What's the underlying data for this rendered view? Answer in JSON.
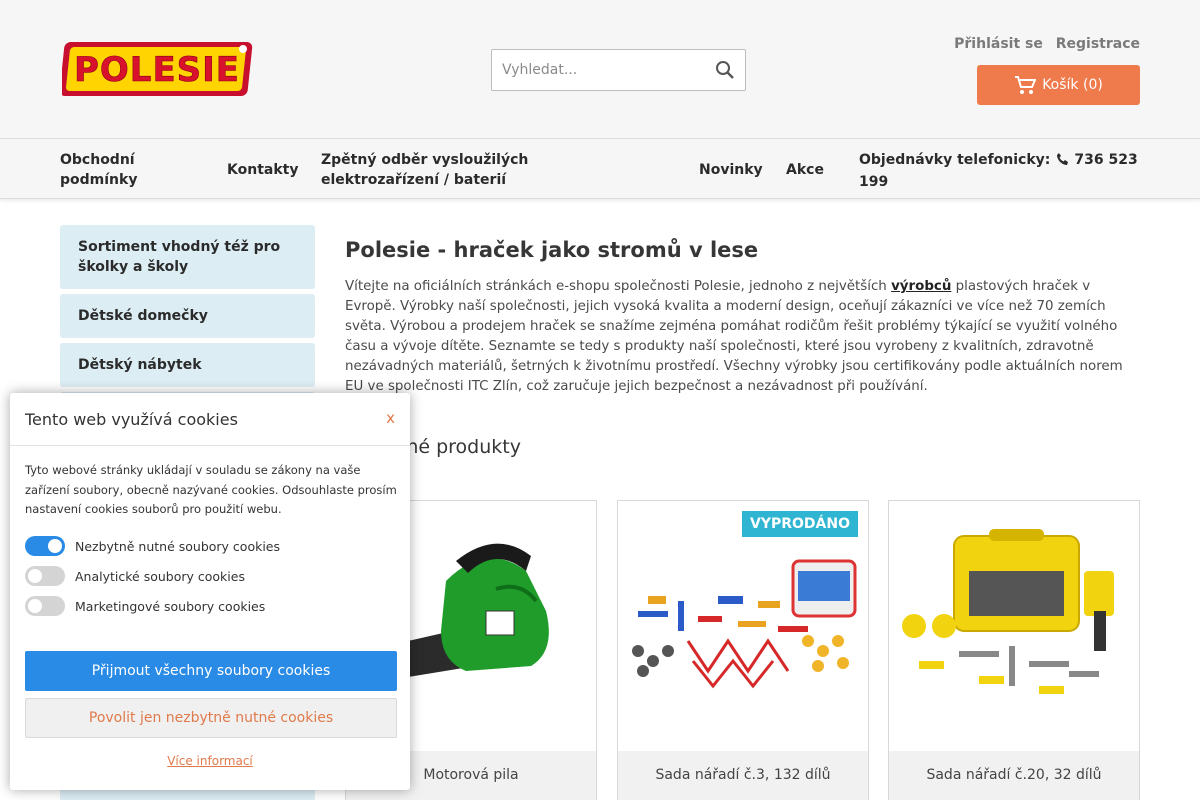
{
  "header": {
    "logo_text": "POLESIE",
    "search_placeholder": "Vyhledat...",
    "login": "Přihlásit se",
    "register": "Registrace",
    "cart": "Košík (0)"
  },
  "nav": {
    "items": [
      "Obchodní podmínky",
      "Kontakty",
      "Zpětný odběr vysloužilých elektrozařízení / baterií",
      "Novinky",
      "Akce"
    ],
    "phone_label": "Objednávky telefonicky:",
    "phone_number": "736 523 199"
  },
  "sidebar": {
    "items": [
      "Sortiment vhodný též pro školky a školy",
      "Dětské domečky",
      "Dětský nábytek"
    ]
  },
  "main": {
    "title": "Polesie - hraček jako stromů v lese",
    "intro_1": "Vítejte na oficiálních stránkách e-shopu společnosti Polesie, jednoho z největších ",
    "intro_link": "výrobců",
    "intro_2": " plastových hraček v Evropě. Výrobky naší společnosti, jejich vysoká kvalita a moderní design, oceňují zákazníci ve více než 70 zemích světa. Výrobou a prodejem hraček se snažíme zejména pomáhat rodičům řešit problémy týkající se využití volného času a vývoje dítěte. Seznamte se tedy s produkty naší společnosti, které jsou vyrobeny z kvalitních, zdravotně nezávadných materiálů, šetrných k životnímu prostředí. Všechny výrobky jsou certifikovány podle aktuálních norem EU ve společnosti ITC Zlín, což zaručuje jejich bezpečnost a nezávadnost při používání.",
    "section_title": "Oblíbené produkty"
  },
  "products": [
    {
      "name": "Motorová pila"
    },
    {
      "name": "Sada nářadí č.3, 132 dílů",
      "badge": "VYPRODÁNO"
    },
    {
      "name": "Sada nářadí č.20, 32 dílů"
    }
  ],
  "cookies": {
    "title": "Tento web využívá cookies",
    "close": "x",
    "text": "Tyto webové stránky ukládají v souladu se zákony na vaše zařízení soubory, obecně nazývané cookies. Odsouhlaste prosím nastavení cookies souborů pro použití webu.",
    "toggles": [
      {
        "label": "Nezbytně nutné soubory cookies",
        "on": true
      },
      {
        "label": "Analytické soubory cookies",
        "on": false
      },
      {
        "label": "Marketingové soubory cookies",
        "on": false
      }
    ],
    "accept_all": "Přijmout všechny soubory cookies",
    "necessary_only": "Povolit jen nezbytně nutné cookies",
    "more": "Více informací"
  },
  "colors": {
    "accent": "#ef7a4b",
    "primary_blue": "#2a8be6",
    "sidebar_bg": "#dcedf4",
    "badge": "#2fb5d2"
  }
}
